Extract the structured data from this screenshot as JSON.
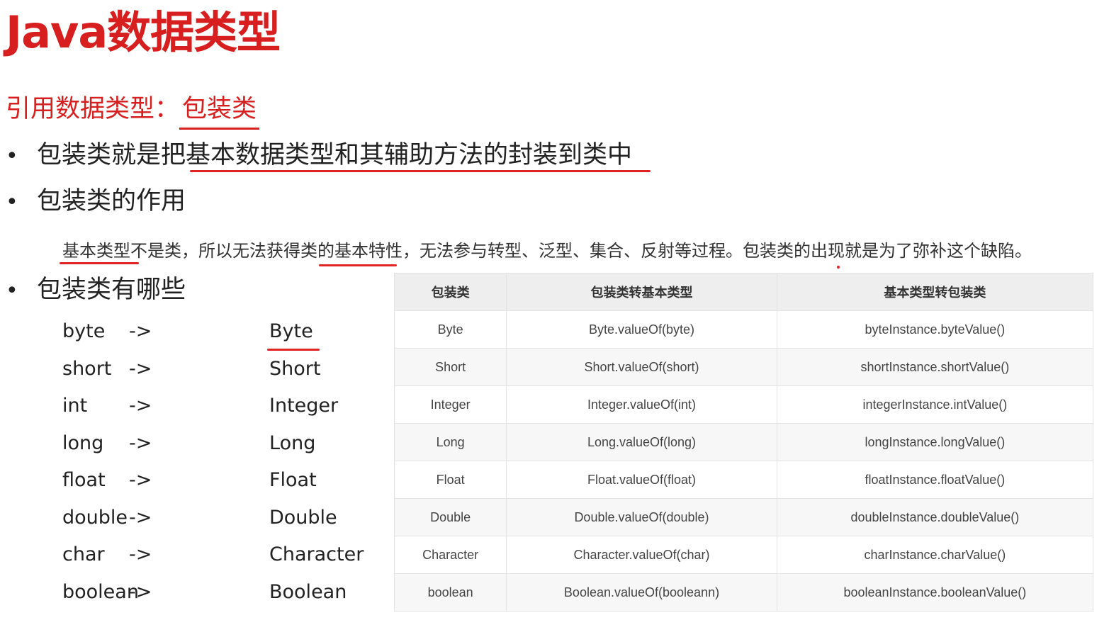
{
  "title": "Java数据类型",
  "subtitle": {
    "prefix": "引用数据类型：",
    "highlight": "包装类"
  },
  "bullets": {
    "b1_prefix": "包装类就是把",
    "b1_underlined": "基本数据类型和其辅助方法的封装到类中",
    "b2": "包装类的作用",
    "b3": "包装类有哪些"
  },
  "description": "基本类型不是类，所以无法获得类的基本特性，无法参与转型、泛型、集合、反射等过程。包装类的出现就是为了弥补这个缺陷。",
  "mapping": [
    {
      "prim": "byte",
      "arrow": "->",
      "wrap": "Byte"
    },
    {
      "prim": "short",
      "arrow": "->",
      "wrap": "Short"
    },
    {
      "prim": "int",
      "arrow": "->",
      "wrap": "Integer"
    },
    {
      "prim": "long",
      "arrow": "->",
      "wrap": "Long"
    },
    {
      "prim": "float",
      "arrow": "->",
      "wrap": "Float"
    },
    {
      "prim": "double",
      "arrow": "->",
      "wrap": "Double"
    },
    {
      "prim": "char",
      "arrow": "->",
      "wrap": "Character"
    },
    {
      "prim": "boolean",
      "arrow": "->",
      "wrap": "Boolean"
    }
  ],
  "table": {
    "headers": [
      "包装类",
      "包装类转基本类型",
      "基本类型转包装类"
    ],
    "rows": [
      [
        "Byte",
        "Byte.valueOf(byte)",
        "byteInstance.byteValue()"
      ],
      [
        "Short",
        "Short.valueOf(short)",
        "shortInstance.shortValue()"
      ],
      [
        "Integer",
        "Integer.valueOf(int)",
        "integerInstance.intValue()"
      ],
      [
        "Long",
        "Long.valueOf(long)",
        "longInstance.longValue()"
      ],
      [
        "Float",
        "Float.valueOf(float)",
        "floatInstance.floatValue()"
      ],
      [
        "Double",
        "Double.valueOf(double)",
        "doubleInstance.doubleValue()"
      ],
      [
        "Character",
        "Character.valueOf(char)",
        "charInstance.charValue()"
      ],
      [
        "boolean",
        "Boolean.valueOf(booleann)",
        "booleanInstance.booleanValue()"
      ]
    ]
  },
  "colors": {
    "accent": "#d81f1f",
    "annotation": "#e02424"
  }
}
